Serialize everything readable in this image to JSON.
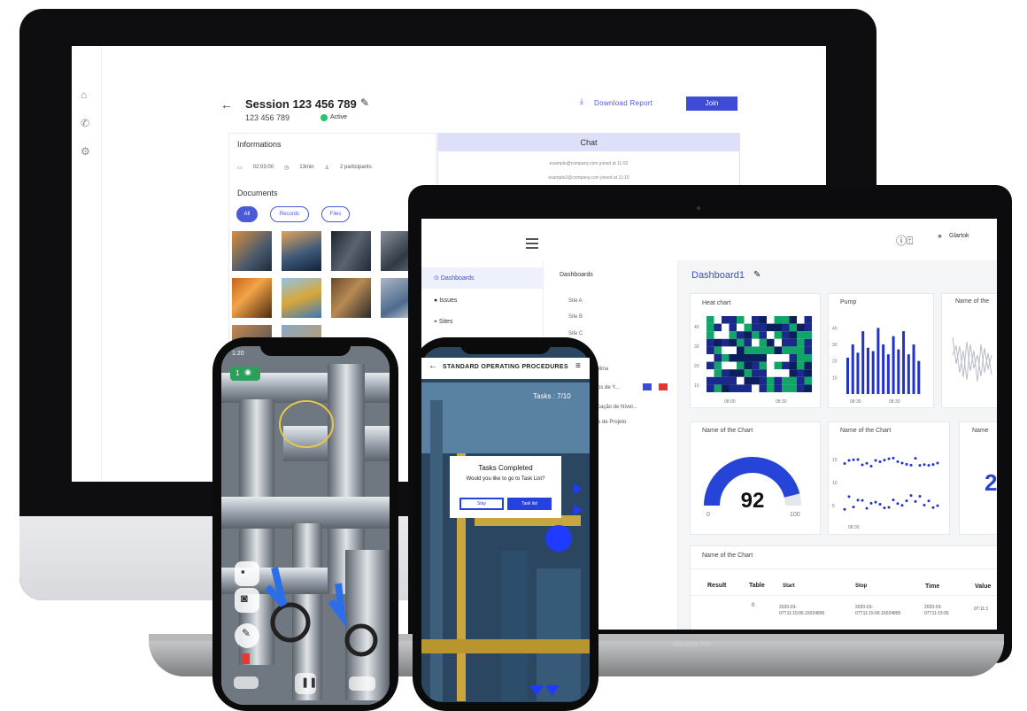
{
  "desktop": {
    "session_title": "Session 123 456 789",
    "session_number": "123 456 789",
    "status": "Active",
    "download_label": "Download Report",
    "join_label": "Join",
    "informations_title": "Informations",
    "info_date": "02:03:00",
    "info_duration": "13min",
    "info_participants": "2 participants",
    "documents_title": "Documents",
    "filters": [
      "All",
      "Records",
      "Files"
    ],
    "chat_title": "Chat",
    "chat_lines": [
      "example@company.com joined at 11:02",
      "example2@company.com joined at 11:10"
    ]
  },
  "laptop": {
    "location_label": "Glartok",
    "nav": [
      "Dashboards",
      "Issues",
      "Sites"
    ],
    "col2_header": "Dashboards",
    "sites": [
      "Site A",
      "Site B",
      "Site C"
    ],
    "list_rows": [
      "…rotina",
      "…cos de Y...",
      "…ficação de Nível...",
      "…os de Projeto"
    ],
    "dashboard_title": "Dashboard1",
    "panel_heat": "Heat chart",
    "panel_pump": "Pump",
    "panel_name3": "Name of the",
    "panel_gauge": "Name of the Chart",
    "panel_scatter": "Name of the Chart",
    "panel_name6": "Name",
    "panel_big_digit": "2",
    "panel_table": "Name of the Chart",
    "table_headers": [
      "Result",
      "Table",
      "Start",
      "Stop",
      "Time",
      "Value"
    ],
    "table_row": [
      "",
      "0",
      "2020-03-07T11:15:06.15024895",
      "2020-03-07T11:15:06.15024895",
      "2020-03-07T11:15:05",
      "07:11:1"
    ],
    "brand": "MacBook Pro"
  },
  "chart_data": [
    {
      "type": "heatmap",
      "title": "Heat chart",
      "x_ticks": [
        "08:00",
        "08:30"
      ],
      "y_ticks": [
        "40",
        "30",
        "20",
        "10"
      ],
      "colors": [
        "#1b2a8a",
        "#13a46a",
        "#ffffff",
        "#0b1f5c"
      ]
    },
    {
      "type": "bar",
      "title": "Pump",
      "values": [
        22,
        30,
        25,
        38,
        28,
        26,
        40,
        30,
        24,
        35,
        27,
        38,
        24,
        30,
        20
      ],
      "y_ticks": [
        "40",
        "30",
        "20",
        "10"
      ],
      "x_ticks": [
        "08:30",
        "08:30"
      ],
      "ylim": [
        0,
        45
      ],
      "color": "#2133c9"
    },
    {
      "type": "gauge",
      "title": "Name of the Chart",
      "value": 92,
      "min": 0,
      "max": 100,
      "color": "#2744d9"
    },
    {
      "type": "scatter",
      "title": "Name of the Chart",
      "y_ticks": [
        "15",
        "10",
        "5"
      ],
      "x_ticks": [
        "08:30"
      ],
      "color": "#2133c9"
    }
  ],
  "phone1": {
    "time": "1:20",
    "badge": "1"
  },
  "phone2": {
    "header": "STANDARD OPERATING PROCEDURES",
    "tasks": "Tasks : 7/10",
    "modal_title": "Tasks Completed",
    "modal_sub": "Would you like to go to Task List?",
    "stay": "Stay",
    "task_list": "Task list"
  }
}
